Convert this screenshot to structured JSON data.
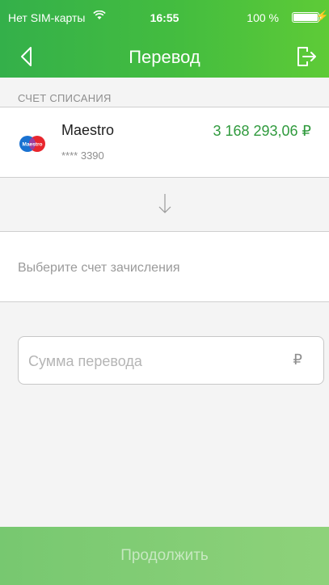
{
  "status_bar": {
    "carrier": "Нет SIM-карты",
    "time": "16:55",
    "battery": "100 %"
  },
  "nav": {
    "title": "Перевод",
    "back_icon": "chevron-left-icon",
    "exit_icon": "logout-icon"
  },
  "source": {
    "section_label": "СЧЕТ СПИСАНИЯ",
    "card_name": "Maestro",
    "card_mask": "**** 3390",
    "balance": "3 168 293,06 ₽",
    "logo_text": "Maestro"
  },
  "target": {
    "label": "Выберите счет зачисления"
  },
  "amount": {
    "placeholder": "Сумма перевода",
    "currency": "₽"
  },
  "actions": {
    "continue_label": "Продолжить"
  },
  "colors": {
    "brand_green": "#44bd3f",
    "balance_green": "#2f9a3d",
    "button_green": "#84cf76"
  }
}
